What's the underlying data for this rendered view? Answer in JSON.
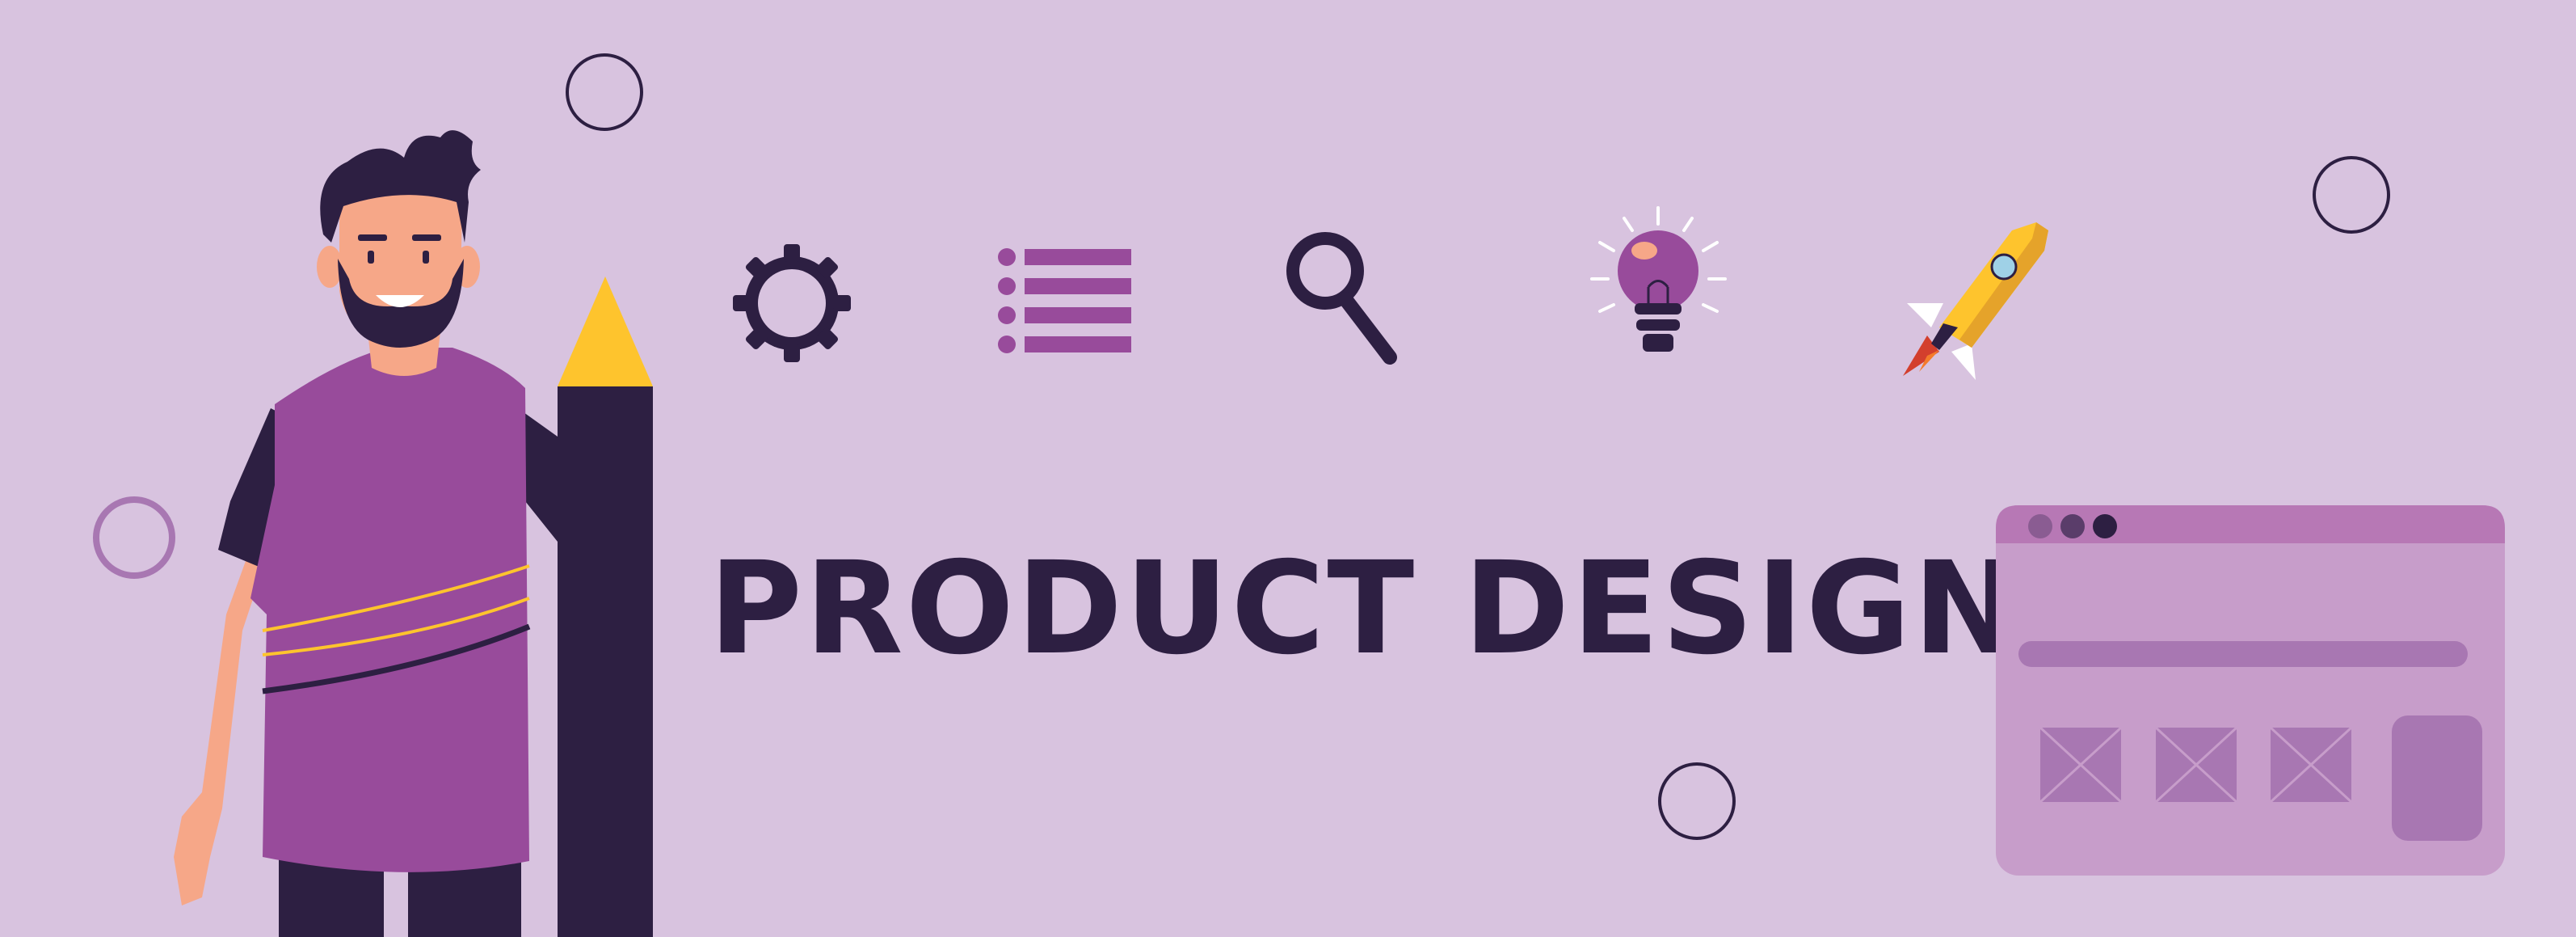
{
  "banner": {
    "title": "PRODUCT DESIGN"
  },
  "icons": [
    "gear-icon",
    "list-icon",
    "search-icon",
    "lightbulb-icon",
    "rocket-icon"
  ],
  "colors": {
    "background": "#d8c3df",
    "title": "#2d1f42",
    "accent_purple": "#984b9b",
    "dark_navy": "#2d1f42",
    "pencil_tip": "#fec42d",
    "browser_body": "#c79dca",
    "browser_bar": "#b778b5",
    "browser_block": "#a877b2",
    "skin": "#f6a788"
  }
}
